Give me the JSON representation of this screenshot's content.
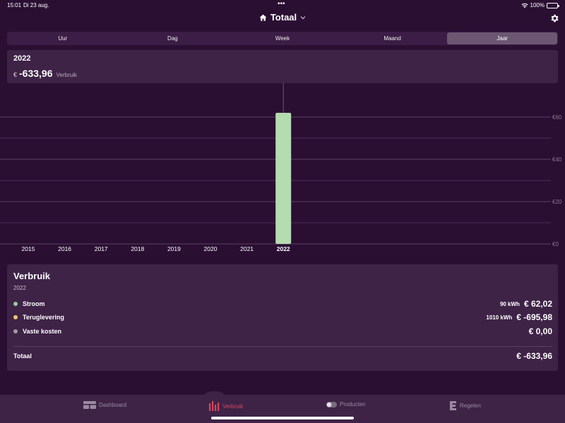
{
  "status_bar": {
    "time": "15:01",
    "date": "Di 23 aug.",
    "dots": "•••",
    "battery": "100%"
  },
  "header": {
    "title": "Totaal"
  },
  "tabs": [
    {
      "label": "Uur",
      "active": false
    },
    {
      "label": "Dag",
      "active": false
    },
    {
      "label": "Week",
      "active": false
    },
    {
      "label": "Maand",
      "active": false
    },
    {
      "label": "Jaar",
      "active": true
    }
  ],
  "summary": {
    "year": "2022",
    "currency": "€",
    "amount": "-633,96",
    "label": "Verbruik"
  },
  "chart_data": {
    "type": "bar",
    "categories": [
      "2015",
      "2016",
      "2017",
      "2018",
      "2019",
      "2020",
      "2021",
      "2022"
    ],
    "values": [
      0,
      0,
      0,
      0,
      0,
      0,
      0,
      62.02
    ],
    "selected": "2022",
    "y_tick_labels": [
      "€60",
      "€40",
      "€20",
      "€0"
    ],
    "y_ticks": [
      60,
      40,
      20,
      0
    ],
    "ylim": [
      0,
      70
    ],
    "grid": true,
    "bar_color": "#b5dbb0"
  },
  "breakdown": {
    "title": "Verbruik",
    "subtitle": "2022",
    "rows": [
      {
        "label": "Stroom",
        "kwh": "90 kWh",
        "amount": "€ 62,02",
        "dot_color": "#8fd19a"
      },
      {
        "label": "Teruglevering",
        "kwh": "1010 kWh",
        "amount": "€ -695,98",
        "dot_color": "#f5c36b"
      },
      {
        "label": "Vaste kosten",
        "kwh": "",
        "amount": "€ 0,00",
        "dot_color": "#9e9e9e"
      }
    ],
    "total_label": "Totaal",
    "total_amount": "€ -633,96"
  },
  "bottom_nav": {
    "dashboard": "Dashboard",
    "verbruik": "Verbruik",
    "producten": "Producten",
    "regelen": "Regelen"
  },
  "colors": {
    "background": "#2a0f33",
    "card": "#3e2347",
    "accent": "#d6455a",
    "bar": "#b5dbb0"
  }
}
